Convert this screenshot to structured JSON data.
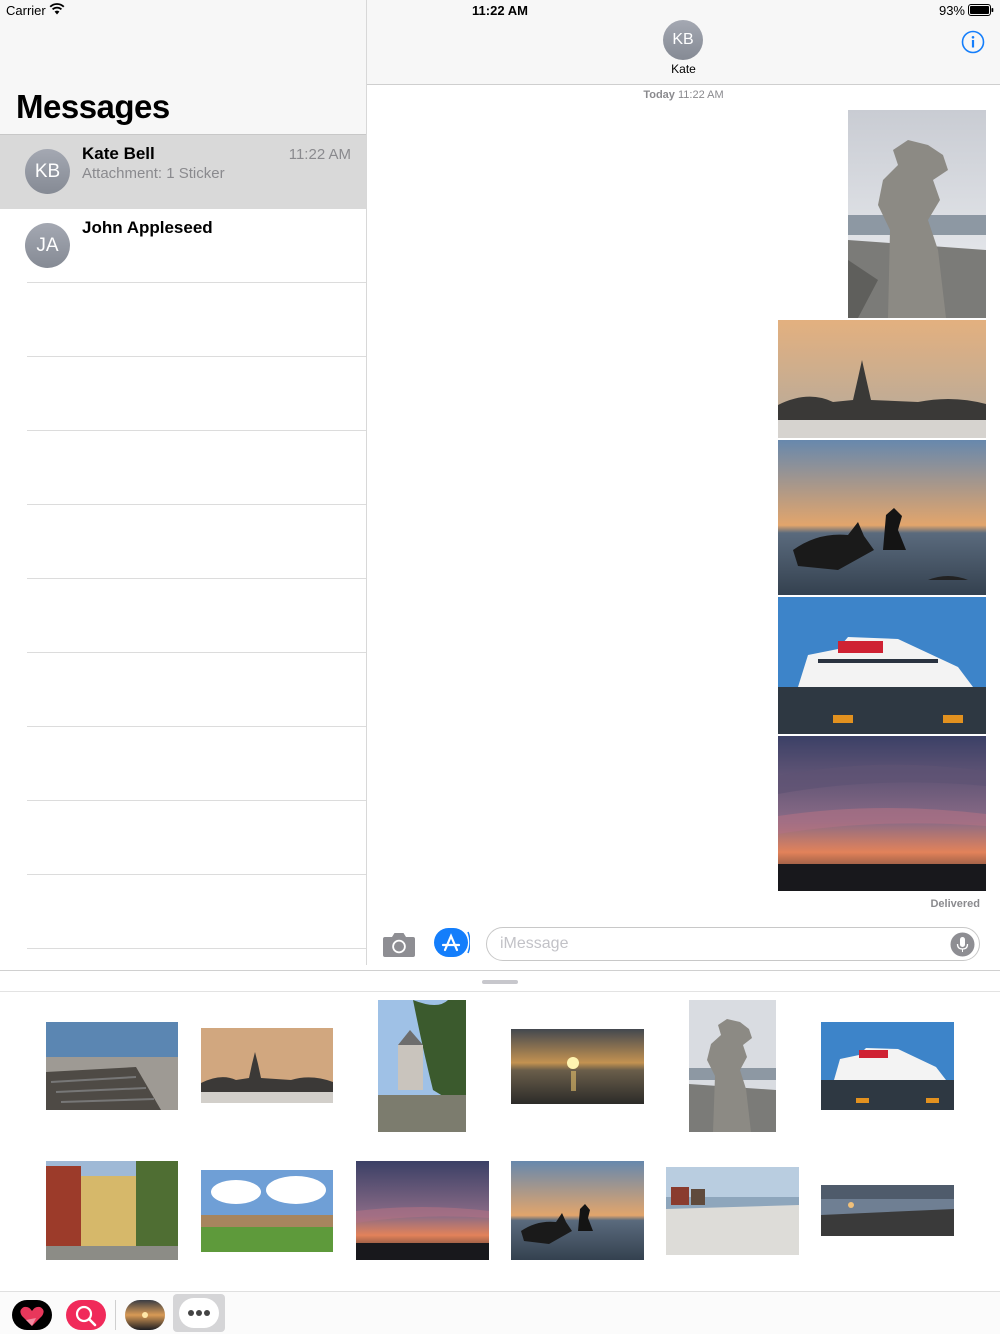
{
  "status_bar": {
    "carrier": "Carrier",
    "time": "11:22 AM",
    "battery": "93%"
  },
  "sidebar": {
    "title": "Messages",
    "conversations": [
      {
        "initials": "KB",
        "name": "Kate Bell",
        "preview": "Attachment: 1 Sticker",
        "time": "11:22 AM",
        "selected": true
      },
      {
        "initials": "JA",
        "name": "John Appleseed",
        "preview": "",
        "time": "",
        "selected": false
      }
    ]
  },
  "chat": {
    "contact_initials": "KB",
    "contact_name": "Kate",
    "timestamp_day": "Today",
    "timestamp_time": "11:22 AM",
    "delivered": "Delivered",
    "photos": [
      "rock-formation",
      "church-sunset",
      "sea-stacks-sunset",
      "ferry-ship",
      "cloudy-sunset"
    ]
  },
  "input": {
    "placeholder": "iMessage"
  },
  "drawer": {
    "thumbnails": [
      "wooden-pier",
      "church-sunset",
      "castle-trees",
      "sunset-sea",
      "rock-formation",
      "ferry-ship",
      "old-town-street",
      "town-panorama",
      "cloudy-sunset",
      "sea-stacks-sunset",
      "beach-huts",
      "rocky-shore"
    ]
  },
  "app_strip": {
    "icons": [
      "heart-sticker-app-icon",
      "search-images-app-icon",
      "photo-app-icon",
      "more-apps-icon"
    ]
  }
}
